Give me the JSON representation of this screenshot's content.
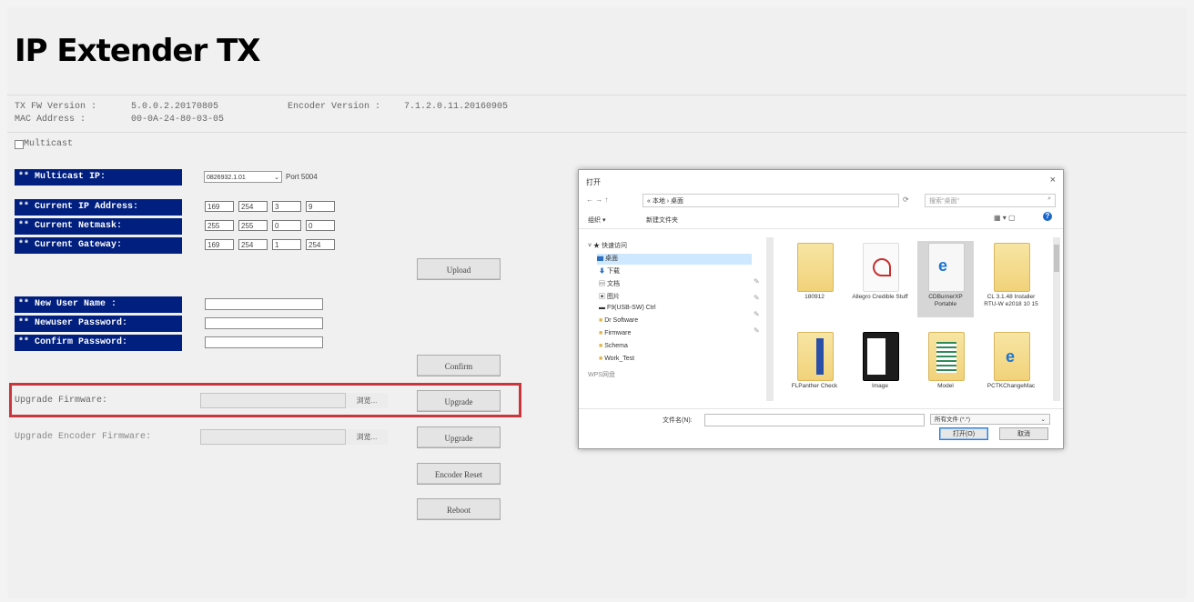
{
  "app": {
    "title": "IP Extender TX"
  },
  "info": {
    "tx_fw_label": "TX FW Version :",
    "tx_fw_value": "5.0.0.2.20170805",
    "encoder_label": "Encoder Version :",
    "encoder_value": "7.1.2.0.11.20160905",
    "mac_label": "MAC Address :",
    "mac_value": "00-0A-24-80-03-05"
  },
  "multicast": {
    "checkbox_label": "Multicast",
    "ip_label": "** Multicast IP:",
    "ip_value": "0826932.1.01",
    "port_label": "Port 5004"
  },
  "network": {
    "ip_label": "** Current IP Address:",
    "mask_label": "** Current Netmask:",
    "gw_label": "** Current Gateway:",
    "ip": [
      "169",
      "254",
      "3",
      "9"
    ],
    "mask": [
      "255",
      "255",
      "0",
      "0"
    ],
    "gw": [
      "169",
      "254",
      "1",
      "254"
    ],
    "apply_button": "Upload"
  },
  "users": {
    "name_label": "** New User Name :",
    "pass_label": "** Newuser Password:",
    "confirm_label": "** Confirm Password:",
    "confirm_button": "Confirm"
  },
  "firmware": {
    "upgrade_label": "Upgrade Firmware:",
    "browse_label": "浏览...",
    "upgrade_button": "Upgrade",
    "encoder_label": "Upgrade Encoder Firmware:",
    "encoder_browse_label": "浏览...",
    "encoder_upgrade_button": "Upgrade",
    "encoder_reset_button": "Encoder Reset",
    "reboot_button": "Reboot"
  },
  "dialog": {
    "title": "打开",
    "close": "×",
    "path": "« 本地 › 桌面",
    "search_placeholder": "搜索\"桌面\"",
    "organize": "组织 ▾",
    "new_folder": "新建文件夹",
    "nav": [
      "快速访问",
      "桌面",
      "下载",
      "文档",
      "图片",
      "F9(USB-SW) Ctrl",
      "Dr Software",
      "Firmware",
      "Schema",
      "Work_Test",
      "WPS网盘"
    ],
    "files": [
      {
        "name": "180912",
        "icon": "folder-icon"
      },
      {
        "name": "Allegro Credible Stuff",
        "icon": "pdf-icon"
      },
      {
        "name": "CDBurnerXP Portable",
        "icon": "edge-icon"
      },
      {
        "name": "CL 3.1.48 Installer RTU-W e2018 10 15",
        "icon": "folder-icon"
      },
      {
        "name": "FLPanther Check",
        "icon": "folder-icon"
      },
      {
        "name": "Image",
        "icon": "image-icon"
      },
      {
        "name": "Model",
        "icon": "spreadsheet-icon"
      },
      {
        "name": "PCTKChangeMac",
        "icon": "edge-icon"
      }
    ],
    "filename_label": "文件名(N):",
    "filetype_value": "所有文件 (*.*)",
    "open_button": "打开(O)",
    "cancel_button": "取消"
  }
}
